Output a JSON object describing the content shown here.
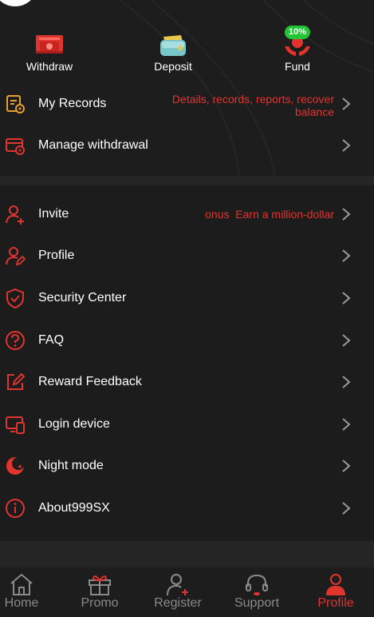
{
  "quick_actions": [
    {
      "label": "Withdraw",
      "icon": "withdraw-icon"
    },
    {
      "label": "Deposit",
      "icon": "deposit-wallet-icon"
    },
    {
      "label": "Fund",
      "icon": "fund-icon",
      "badge": "10%"
    }
  ],
  "menu_group_1": [
    {
      "label": "My Records",
      "hint_line1": "Details, records, reports, recover",
      "hint_line2": "balance",
      "icon": "records-icon"
    },
    {
      "label": "Manage withdrawal",
      "icon": "manage-withdrawal-icon"
    }
  ],
  "menu_group_2": [
    {
      "label": "Invite",
      "hint": "onus  Earn a million-dollar",
      "icon": "invite-icon"
    },
    {
      "label": "Profile",
      "icon": "profile-edit-icon"
    },
    {
      "label": "Security Center",
      "icon": "shield-icon"
    },
    {
      "label": "FAQ",
      "icon": "question-icon"
    },
    {
      "label": "Reward Feedback",
      "icon": "feedback-edit-icon"
    },
    {
      "label": "Login device",
      "icon": "device-icon"
    },
    {
      "label": "Night mode",
      "icon": "moon-icon"
    },
    {
      "label": "About999SX",
      "icon": "info-icon"
    }
  ],
  "bottom_nav": [
    {
      "label": "Home",
      "icon": "home-icon"
    },
    {
      "label": "Promo",
      "icon": "gift-icon"
    },
    {
      "label": "Register",
      "icon": "register-user-icon"
    },
    {
      "label": "Support",
      "icon": "headset-icon"
    },
    {
      "label": "Profile",
      "icon": "profile-icon",
      "active": true
    }
  ],
  "colors": {
    "accent": "#e2342e",
    "background": "#1c1c1d",
    "divider": "#252526",
    "badge": "#24c436",
    "inactive_nav": "#8a8a8a"
  }
}
